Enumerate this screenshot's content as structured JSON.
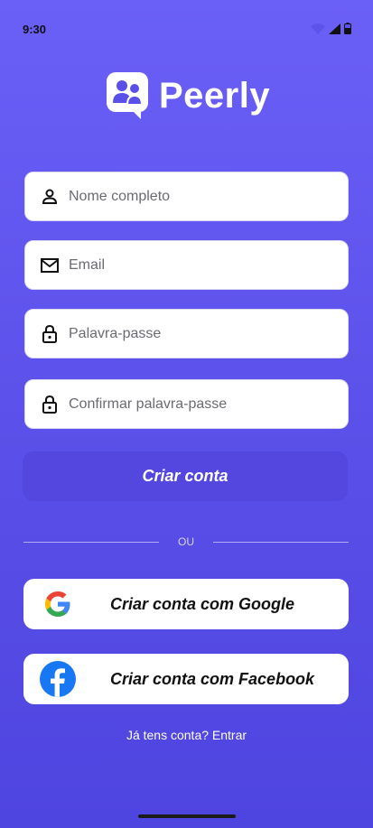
{
  "status_bar": {
    "time": "9:30"
  },
  "app": {
    "name": "Peerly"
  },
  "form": {
    "fields": [
      {
        "placeholder": "Nome completo",
        "value": "",
        "icon": "person-icon"
      },
      {
        "placeholder": "Email",
        "value": "",
        "icon": "mail-icon"
      },
      {
        "placeholder": "Palavra-passe",
        "value": "",
        "icon": "lock-icon"
      },
      {
        "placeholder": "Confirmar palavra-passe",
        "value": "",
        "icon": "lock-icon"
      }
    ],
    "submit_label": "Criar conta"
  },
  "divider": {
    "label": "OU"
  },
  "social": {
    "google_label": "Criar conta com Google",
    "facebook_label": "Criar conta com Facebook"
  },
  "footer": {
    "login_text": "Já tens conta? Entrar"
  },
  "colors": {
    "background_top": "#6a5ff7",
    "background_bottom": "#4e44df",
    "button": "#5347e0",
    "facebook": "#1877f2"
  }
}
